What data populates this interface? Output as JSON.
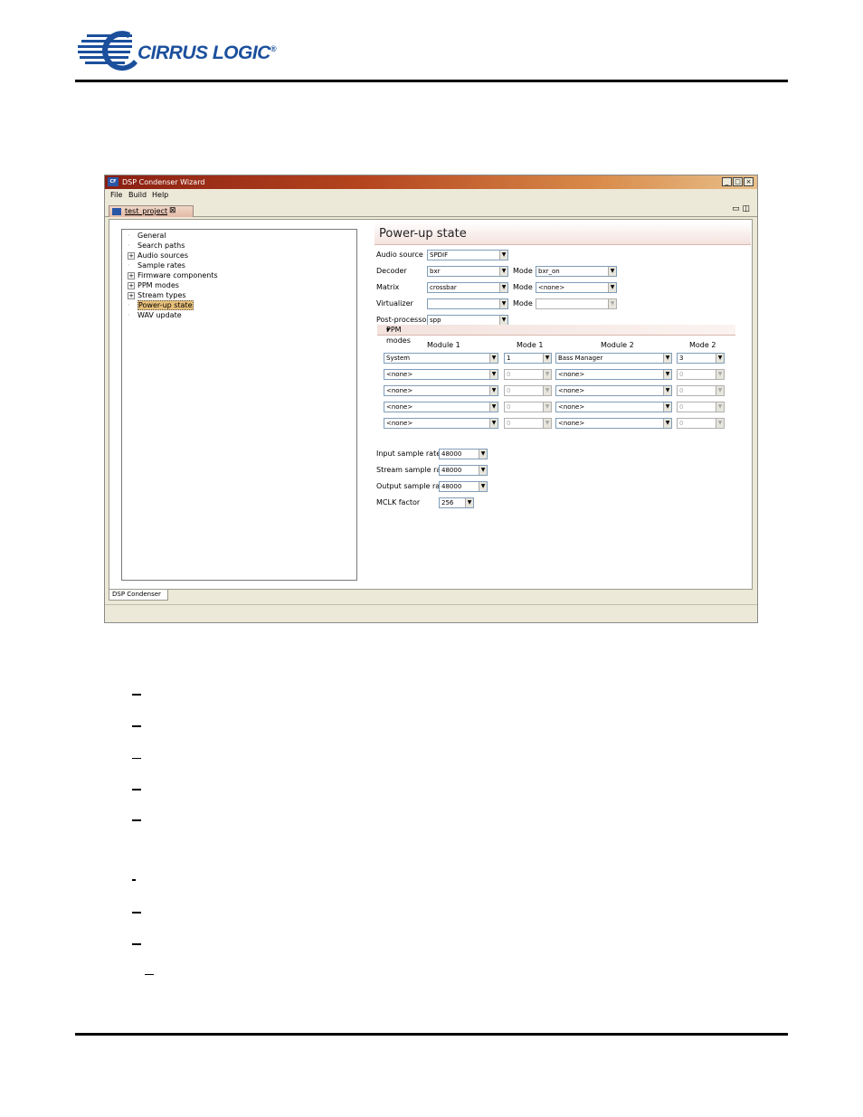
{
  "brand": {
    "logo_text": "CIRRUS LOGIC",
    "logo_mark": "®"
  },
  "window": {
    "title": "DSP Condenser Wizard",
    "app_icon": "CF",
    "menu": [
      "File",
      "Build",
      "Help"
    ],
    "editor_tab": "test_project",
    "editor_tab_close": "⊠",
    "view_tab": "DSP Condenser"
  },
  "tree": [
    {
      "label": "General",
      "expandable": false
    },
    {
      "label": "Search paths",
      "expandable": false
    },
    {
      "label": "Audio sources",
      "expandable": true
    },
    {
      "label": "Sample rates",
      "expandable": false
    },
    {
      "label": "Firmware components",
      "expandable": true
    },
    {
      "label": "PPM modes",
      "expandable": true
    },
    {
      "label": "Stream types",
      "expandable": true
    },
    {
      "label": "Power-up state",
      "expandable": false,
      "selected": true
    },
    {
      "label": "WAV update",
      "expandable": false
    }
  ],
  "form": {
    "heading": "Power-up state",
    "audio_source": {
      "label": "Audio source",
      "value": "SPDIF"
    },
    "decoder": {
      "label": "Decoder",
      "value": "bxr",
      "mode_label": "Mode",
      "mode_value": "bxr_on"
    },
    "matrix": {
      "label": "Matrix",
      "value": "crossbar",
      "mode_label": "Mode",
      "mode_value": "<none>"
    },
    "virtualizer": {
      "label": "Virtualizer",
      "value": "",
      "mode_label": "Mode",
      "mode_value": ""
    },
    "post_processor": {
      "label": "Post-processor",
      "value": "spp"
    },
    "ppm_section": "PPM modes",
    "ppm_columns": [
      "Module 1",
      "Mode 1",
      "Module 2",
      "Mode 2"
    ],
    "ppm_rows": [
      {
        "module1": "System",
        "mode1": "1",
        "module2": "Bass Manager",
        "mode2": "3"
      },
      {
        "module1": "<none>",
        "mode1": "0",
        "module2": "<none>",
        "mode2": "0"
      },
      {
        "module1": "<none>",
        "mode1": "0",
        "module2": "<none>",
        "mode2": "0"
      },
      {
        "module1": "<none>",
        "mode1": "0",
        "module2": "<none>",
        "mode2": "0"
      },
      {
        "module1": "<none>",
        "mode1": "0",
        "module2": "<none>",
        "mode2": "0"
      }
    ],
    "input_rate": {
      "label": "Input sample rate",
      "value": "48000"
    },
    "stream_rate": {
      "label": "Stream sample rate",
      "value": "48000"
    },
    "output_rate": {
      "label": "Output sample rate",
      "value": "48000"
    },
    "mclk": {
      "label": "MCLK factor",
      "value": "256"
    }
  }
}
